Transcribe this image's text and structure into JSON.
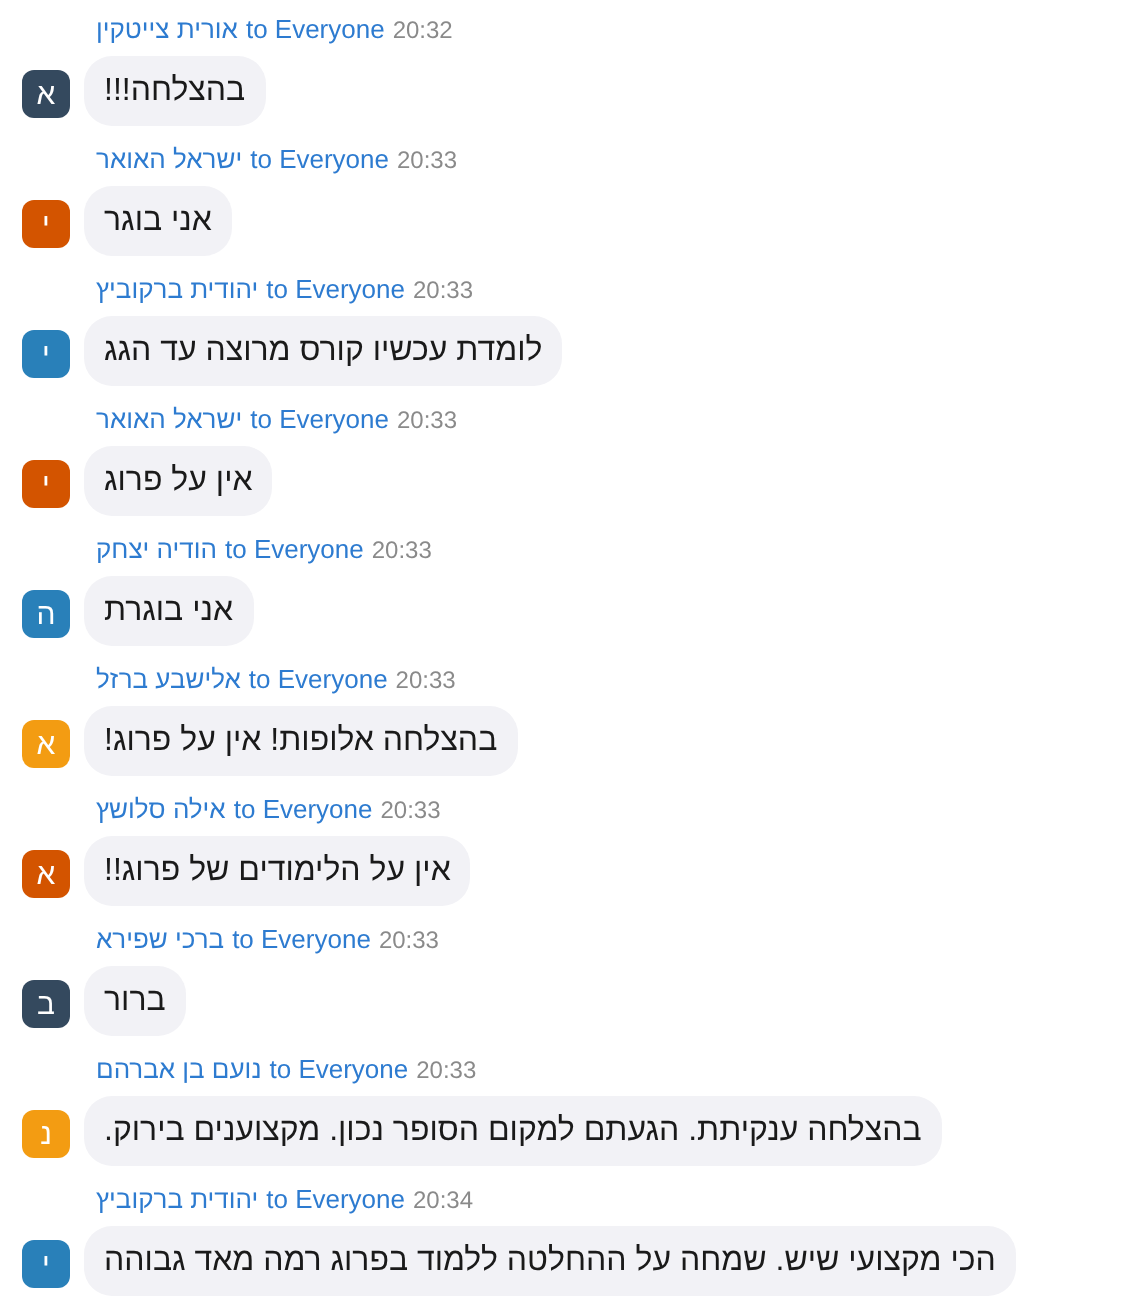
{
  "messages": [
    {
      "sender": "אורית צייטקין",
      "to": "to Everyone",
      "time": "20:32",
      "initial": "א",
      "color": "#34495e",
      "text": "בהצלחה!!!"
    },
    {
      "sender": "ישראל האואר",
      "to": "to Everyone",
      "time": "20:33",
      "initial": "י",
      "color": "#d35400",
      "text": "אני בוגר"
    },
    {
      "sender": "יהודית ברקוביץ",
      "to": "to Everyone",
      "time": "20:33",
      "initial": "י",
      "color": "#2980b9",
      "text": "לומדת עכשיו קורס מרוצה עד הגג"
    },
    {
      "sender": "ישראל האואר",
      "to": "to Everyone",
      "time": "20:33",
      "initial": "י",
      "color": "#d35400",
      "text": "אין על פרוג"
    },
    {
      "sender": "הודיה יצחק",
      "to": "to Everyone",
      "time": "20:33",
      "initial": "ה",
      "color": "#2980b9",
      "text": "אני בוגרת"
    },
    {
      "sender": "אלישבע ברזל",
      "to": "to Everyone",
      "time": "20:33",
      "initial": "א",
      "color": "#f39c12",
      "text": "בהצלחה אלופות! אין על פרוג!"
    },
    {
      "sender": "אילה סלושץ",
      "to": "to Everyone",
      "time": "20:33",
      "initial": "א",
      "color": "#d35400",
      "text": "אין על הלימודים של פרוג!!"
    },
    {
      "sender": "ברכי שפירא",
      "to": "to Everyone",
      "time": "20:33",
      "initial": "ב",
      "color": "#34495e",
      "text": "ברור"
    },
    {
      "sender": "נועם בן אברהם",
      "to": "to Everyone",
      "time": "20:33",
      "initial": "נ",
      "color": "#f39c12",
      "text": "בהצלחה ענקיתת. הגעתם למקום הסופר נכון. מקצוענים בירוק."
    },
    {
      "sender": "יהודית ברקוביץ",
      "to": "to Everyone",
      "time": "20:34",
      "initial": "י",
      "color": "#2980b9",
      "text": "הכי מקצועי שיש. שמחה על ההחלטה ללמוד בפרוג רמה מאד גבוהה"
    }
  ]
}
